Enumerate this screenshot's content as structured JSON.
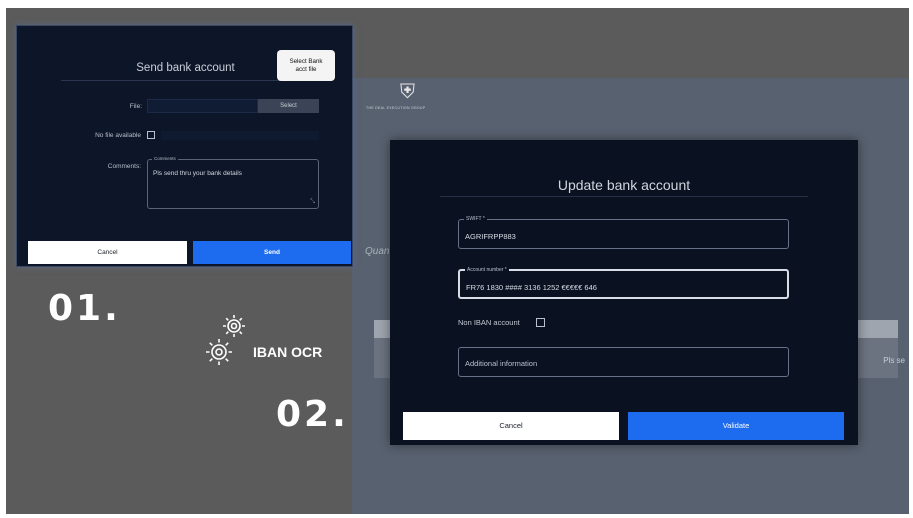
{
  "background_app": {
    "brand": "THE DEAL EXECUTION GROUP",
    "quantity_label": "Quant",
    "row_text": "Pls se"
  },
  "panel1": {
    "title": "Send bank account",
    "tooltip_lines": [
      "Select Bank",
      "acct file"
    ],
    "file_label": "File:",
    "select_label": "Select",
    "no_file_label": "No file available",
    "comments_label": "Comments:",
    "comments_legend": "Comments",
    "comments_value": "Pls send thru your bank details",
    "cancel_label": "Cancel",
    "send_label": "Send"
  },
  "steps": {
    "step1": "01.",
    "step2": "02.",
    "ocr_label": "IBAN OCR",
    "ocr_icon": "gears-icon"
  },
  "panel2": {
    "title": "Update bank account",
    "swift_legend": "SWIFT *",
    "swift_value": "AGRIFRPP883",
    "account_legend": "Account number *",
    "account_value": "FR76 1830 #### 3136 1252 €€€€€ 646",
    "non_iban_label": "Non IBAN account",
    "additional_placeholder": "Additional information",
    "cancel_label": "Cancel",
    "validate_label": "Validate"
  },
  "colors": {
    "primary_blue": "#1d6cf0",
    "panel_bg": "#0a1222",
    "backdrop": "#5b5b5b"
  }
}
